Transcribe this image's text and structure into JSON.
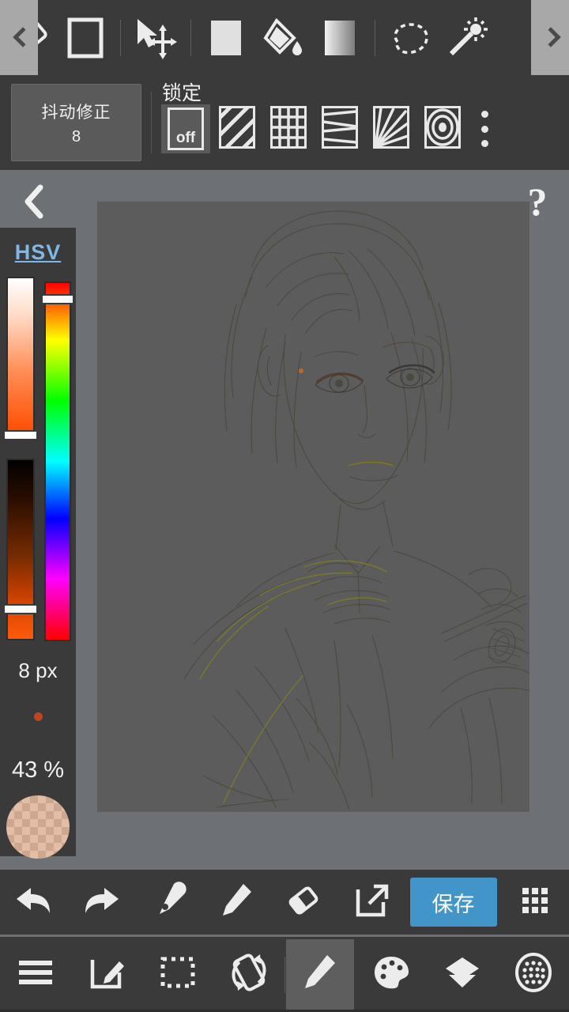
{
  "app": {
    "accent_blue": "#4195c9",
    "bar_bg": "#3a3a3a",
    "canvas_bg": "#5c5c5c",
    "workspace_bg": "#6d7176"
  },
  "top_toolbar": {
    "scroll_left_icon": "chevron-left-icon",
    "scroll_right_icon": "chevron-right-icon",
    "tools": [
      {
        "name": "eraser-tool",
        "icon": "eraser-icon"
      },
      {
        "name": "rectangle-shape-tool",
        "icon": "square-outline-icon"
      },
      {
        "name": "move-transform-tool",
        "icon": "cursor-move-icon"
      },
      {
        "name": "fill-color-tool",
        "icon": "filled-square-icon"
      },
      {
        "name": "bucket-fill-tool",
        "icon": "paint-bucket-icon"
      },
      {
        "name": "gradient-tool",
        "icon": "gradient-square-icon"
      },
      {
        "name": "lasso-select-tool",
        "icon": "lasso-dashed-icon"
      },
      {
        "name": "magic-wand-tool",
        "icon": "magic-wand-icon"
      }
    ]
  },
  "second_toolbar": {
    "jitter": {
      "title": "抖动修正",
      "value": "8"
    },
    "lock": {
      "label": "锁定",
      "patterns": [
        {
          "name": "guide-off",
          "label": "off",
          "active": true
        },
        {
          "name": "guide-diagonal-hatch",
          "label": "",
          "active": false
        },
        {
          "name": "guide-grid",
          "label": "",
          "active": false
        },
        {
          "name": "guide-parallel-lines",
          "label": "",
          "active": false
        },
        {
          "name": "guide-radial-lines",
          "label": "",
          "active": false
        },
        {
          "name": "guide-concentric-circles",
          "label": "",
          "active": false
        }
      ],
      "more_icon": "three-dots-vertical-icon"
    }
  },
  "canvas": {
    "back_icon": "chevron-left-icon",
    "help_label": "?",
    "artwork_description": "pencil sketch of an anime girl portrait"
  },
  "color_panel": {
    "mode_label": "HSV",
    "sliders": [
      {
        "name": "saturation-slider",
        "handle_percent": 97
      },
      {
        "name": "value-slider",
        "handle_percent": 80
      },
      {
        "name": "hue-slider",
        "handle_percent": 4
      }
    ],
    "brush_size": "8 px",
    "opacity": "43 %",
    "current_color_swatch": "#e3bda5",
    "brush_dot_color": "#c0451a"
  },
  "action_bar": {
    "items": [
      {
        "name": "undo-button",
        "icon": "undo-arrow-icon",
        "label": ""
      },
      {
        "name": "redo-button",
        "icon": "redo-arrow-icon",
        "label": ""
      },
      {
        "name": "eyedropper-button",
        "icon": "eyedropper-icon",
        "label": ""
      },
      {
        "name": "pencil-button",
        "icon": "pencil-icon",
        "label": ""
      },
      {
        "name": "eraser-button",
        "icon": "eraser-icon",
        "label": ""
      },
      {
        "name": "export-button",
        "icon": "external-link-icon",
        "label": ""
      }
    ],
    "save_label": "保存",
    "grid_menu_icon": "grid-dots-icon"
  },
  "bottom_nav": {
    "items": [
      {
        "name": "menu-nav",
        "icon": "hamburger-menu-icon",
        "active": false
      },
      {
        "name": "edit-canvas-nav",
        "icon": "edit-square-icon",
        "active": false
      },
      {
        "name": "selection-nav",
        "icon": "dashed-selection-icon",
        "active": false
      },
      {
        "name": "rotate-canvas-nav",
        "icon": "rotate-device-icon",
        "active": false
      },
      {
        "name": "brush-nav",
        "icon": "pencil-icon",
        "active": true
      },
      {
        "name": "palette-nav",
        "icon": "palette-icon",
        "active": false
      },
      {
        "name": "layers-nav",
        "icon": "layers-icon",
        "active": false
      },
      {
        "name": "material-nav",
        "icon": "dotted-circle-icon",
        "active": false
      }
    ]
  }
}
